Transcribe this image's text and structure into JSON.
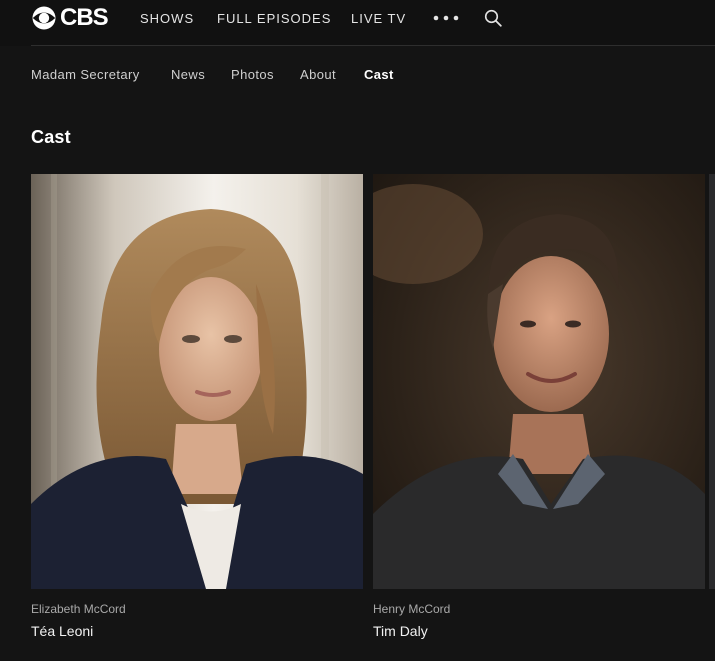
{
  "brand": {
    "logo_text": "CBS"
  },
  "topnav": {
    "items": [
      {
        "label": "SHOWS"
      },
      {
        "label": "FULL EPISODES"
      },
      {
        "label": "LIVE TV"
      }
    ],
    "more_icon": "more-dots-icon",
    "search_icon": "search-icon"
  },
  "subnav": {
    "items": [
      {
        "label": "Madam Secretary",
        "active": false
      },
      {
        "label": "News",
        "active": false
      },
      {
        "label": "Photos",
        "active": false
      },
      {
        "label": "About",
        "active": false
      },
      {
        "label": "Cast",
        "active": true
      }
    ]
  },
  "section": {
    "title": "Cast"
  },
  "cast": [
    {
      "role": "Elizabeth McCord",
      "name": "Téa Leoni"
    },
    {
      "role": "Henry McCord",
      "name": "Tim Daly"
    }
  ],
  "colors": {
    "background": "#141414",
    "nav_background": "#111111",
    "role_text": "#a9a9a9"
  }
}
